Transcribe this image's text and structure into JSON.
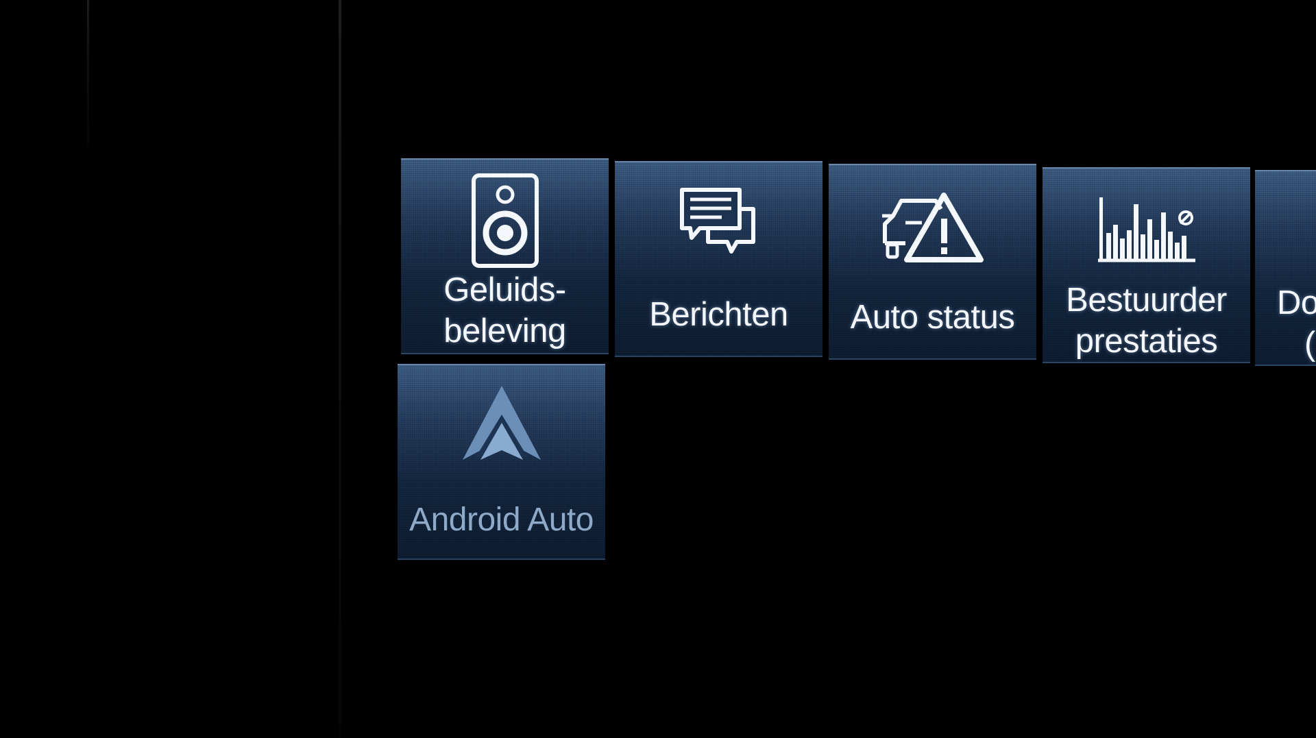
{
  "menu": {
    "tiles": [
      {
        "id": "sound",
        "icon": "speaker-icon",
        "label_line1": "Geluids-",
        "label_line2": "beleving"
      },
      {
        "id": "messages",
        "icon": "chat-bubbles-icon",
        "label": "Berichten"
      },
      {
        "id": "car-status",
        "icon": "car-warning-icon",
        "label": "Auto status"
      },
      {
        "id": "driver-performance",
        "icon": "bar-chart-icon",
        "label_line1": "Bestuurder",
        "label_line2": "prestaties"
      },
      {
        "id": "partial-tile",
        "label_line1": "Do",
        "label_line2": "("
      },
      {
        "id": "android-auto",
        "icon": "android-auto-icon",
        "label": "Android Auto"
      }
    ]
  },
  "colors": {
    "background": "#000000",
    "tile_top": "#3f5f86",
    "tile_bottom": "#0e1e33",
    "label": "#f4f8fc",
    "dim_label": "#8fa9c8"
  }
}
